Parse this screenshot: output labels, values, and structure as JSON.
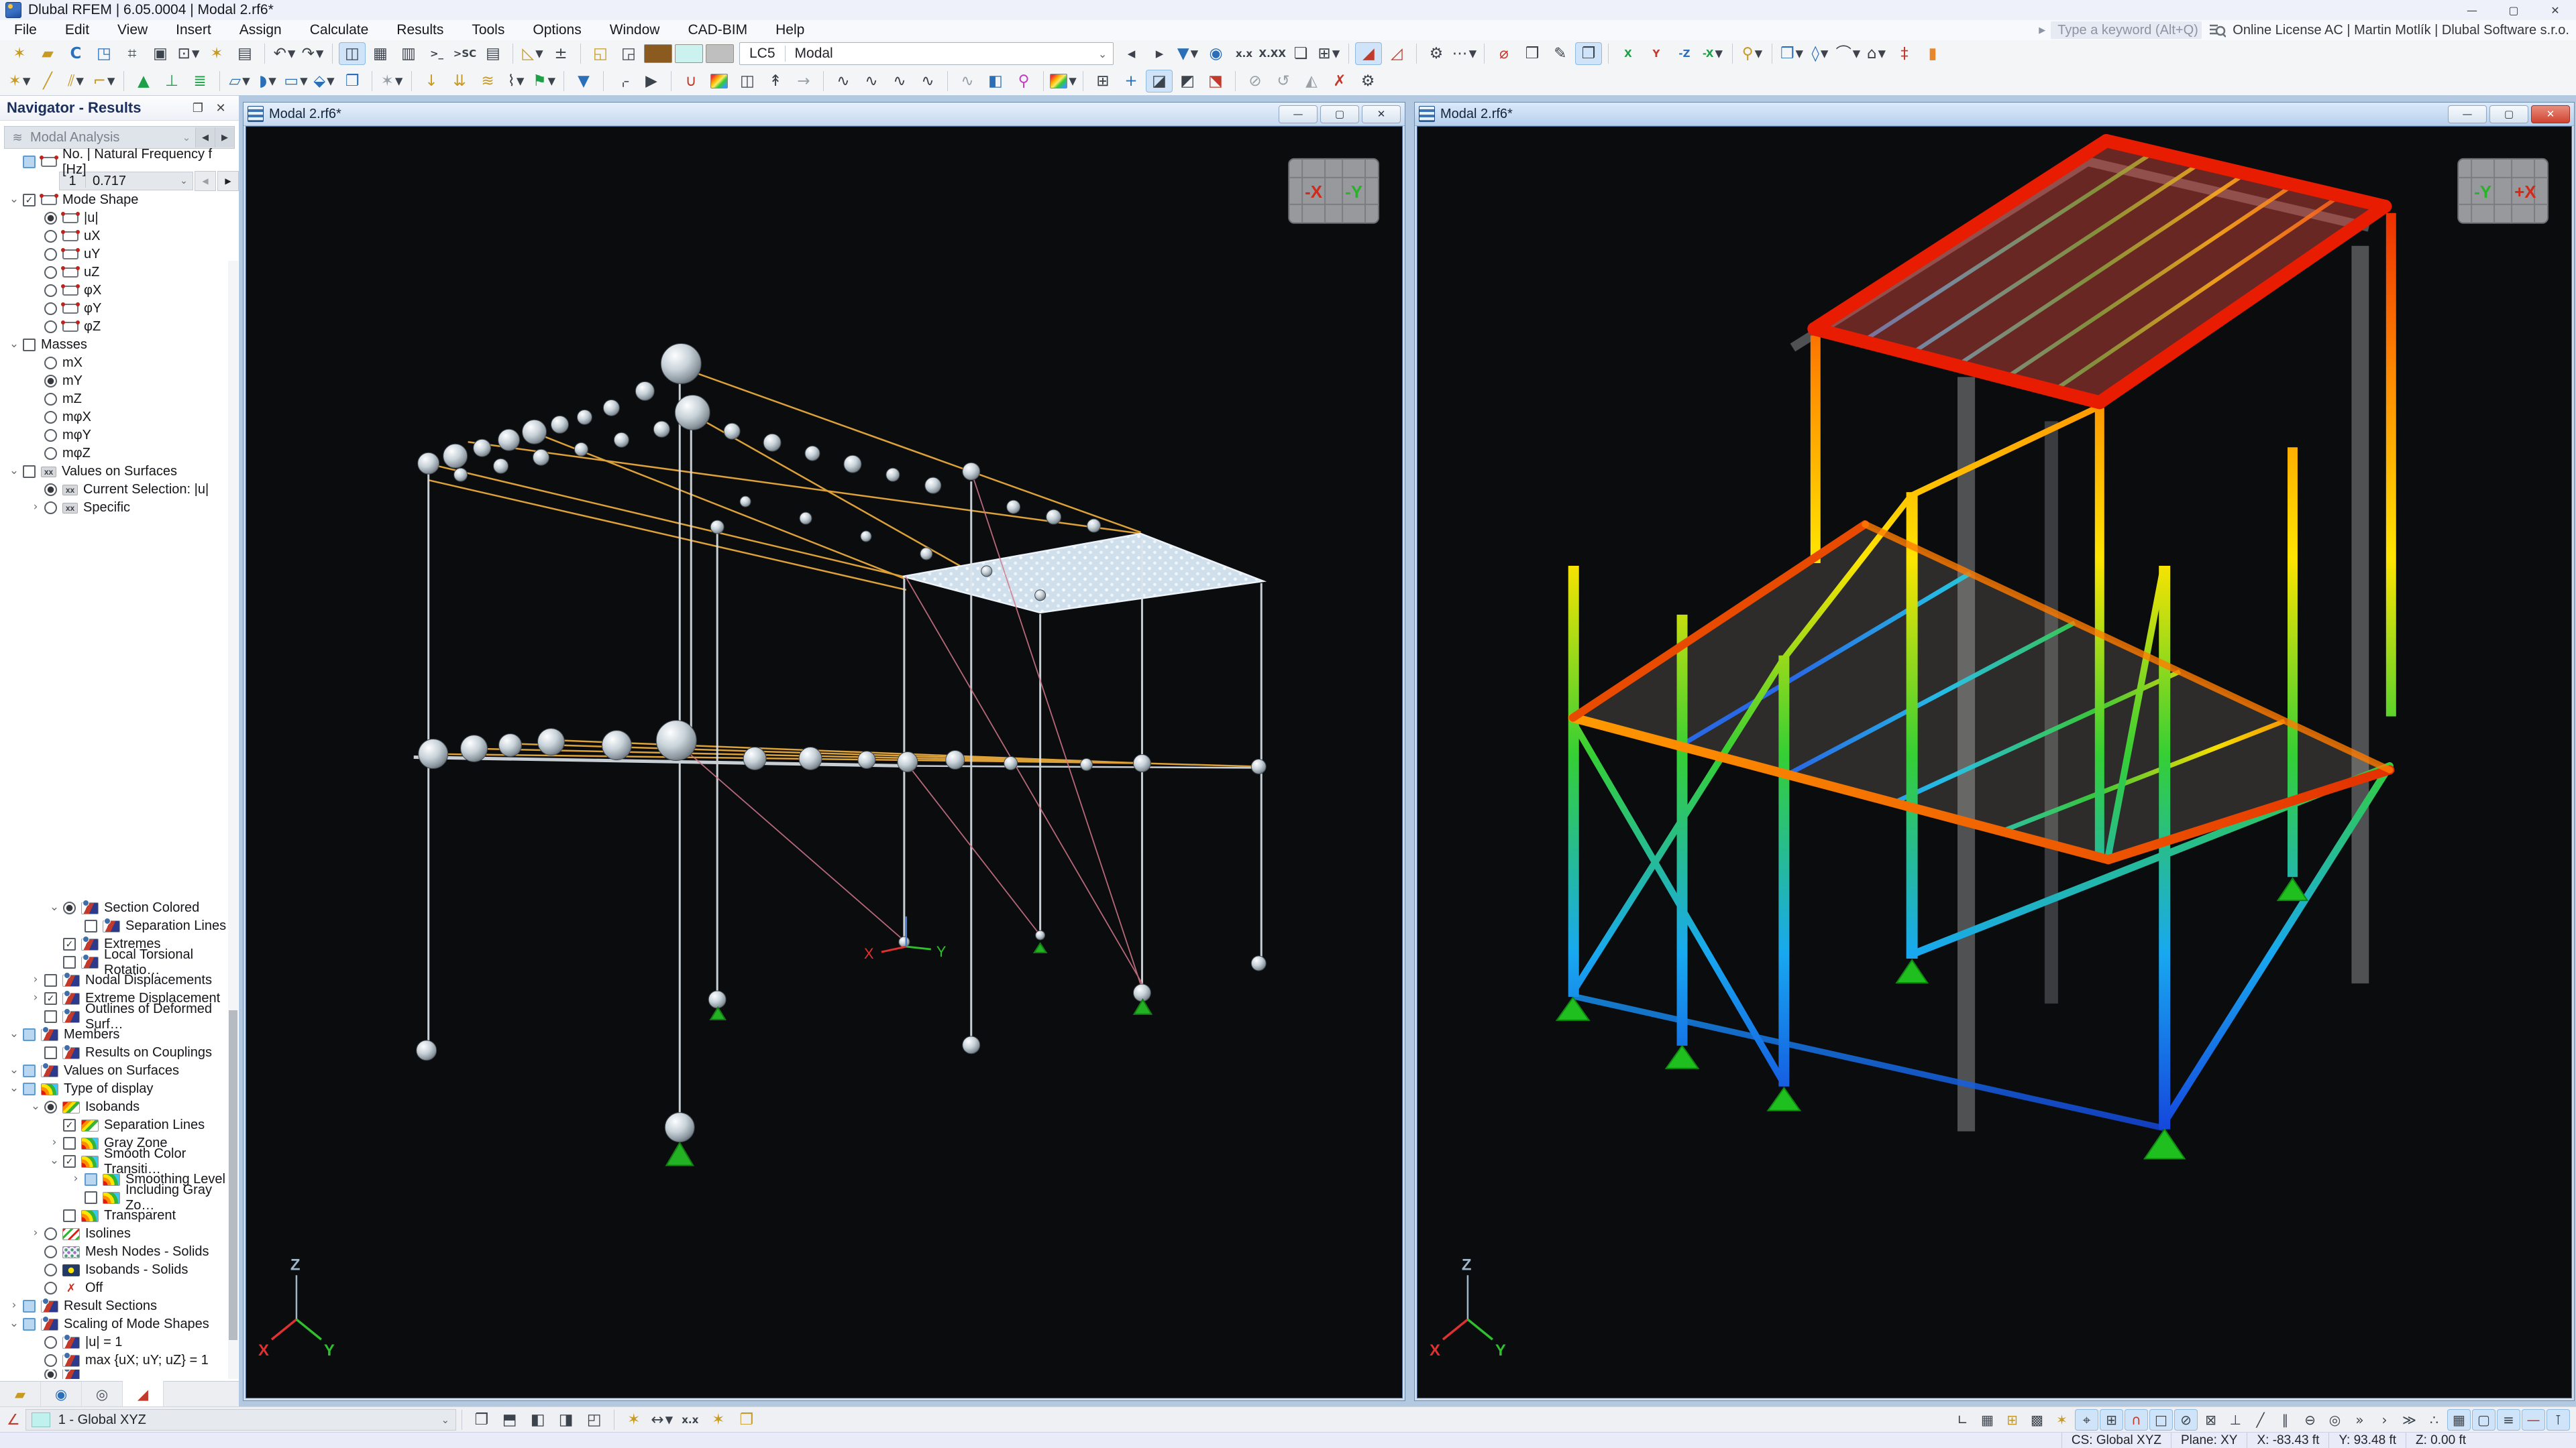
{
  "titlebar": {
    "title": "Dlubal RFEM | 6.05.0004 | Modal 2.rf6*",
    "minimize": "—",
    "maximize": "▢",
    "close": "✕"
  },
  "menubar": {
    "items": [
      "File",
      "Edit",
      "View",
      "Insert",
      "Assign",
      "Calculate",
      "Results",
      "Tools",
      "Options",
      "Window",
      "CAD-BIM",
      "Help"
    ]
  },
  "search": {
    "arrow": "▶",
    "placeholder": "Type a keyword (Alt+Q)",
    "license": "Online License AC | Martin Motlík | Dlubal Software s.r.o."
  },
  "toolbar_combo": {
    "case": "LC5",
    "value": "Modal",
    "chevron": "⌄"
  },
  "toolbar_main_a": {
    "items": [
      {
        "n": "new-model",
        "g": "✶",
        "cl": "c-gold"
      },
      {
        "n": "open-file",
        "g": "▰",
        "cl": "c-gold"
      },
      {
        "n": "block-manager",
        "g": "C",
        "cl": "c-blue b"
      },
      {
        "n": "model-3d-import",
        "g": "◳",
        "cl": "c-blue"
      },
      {
        "n": "edit-tables",
        "g": "⌗"
      },
      {
        "n": "save",
        "g": "▣"
      },
      {
        "n": "print",
        "g": "⊡",
        "dd": 1
      },
      {
        "n": "new-printout-report",
        "g": "✶",
        "cl": "c-gold"
      },
      {
        "n": "printout-report",
        "g": "▤"
      },
      {
        "sep": 1
      },
      {
        "n": "undo",
        "g": "↶",
        "dd": 1
      },
      {
        "n": "redo",
        "g": "↷",
        "dd": 1
      },
      {
        "sep": 1
      },
      {
        "n": "table-panel",
        "g": "◫",
        "hl": 1
      },
      {
        "n": "spreadsheet",
        "g": "▦"
      },
      {
        "n": "result-tables",
        "g": "▥"
      },
      {
        "n": "console",
        "g": ">_",
        "sm": 1
      },
      {
        "n": "script-console",
        "g": ">SC",
        "sm": 1
      },
      {
        "n": "table-view",
        "g": "▤"
      },
      {
        "sep": 1
      },
      {
        "n": "select-surface",
        "g": "◺",
        "cl": "c-gold",
        "dd": 1
      },
      {
        "n": "select-annotation",
        "g": "±"
      },
      {
        "sep": 1
      },
      {
        "n": "new-window",
        "g": "◱",
        "cl": "c-gold"
      },
      {
        "n": "window-import",
        "g": "◲"
      },
      {
        "sw": "#8a5a1f",
        "n": "swatch-brown"
      },
      {
        "sw": "#ccf2ef",
        "n": "swatch-cyan"
      },
      {
        "sw": "#bfbfbf",
        "n": "swatch-gray"
      }
    ]
  },
  "toolbar_main_b": {
    "items": [
      {
        "n": "prev-load-case",
        "g": "◀",
        "sm": 1
      },
      {
        "n": "next-load-case",
        "g": "▶",
        "sm": 1
      },
      {
        "n": "filter-results",
        "g": "▼",
        "cl": "c-blue",
        "dd": 1
      },
      {
        "n": "show-results",
        "g": "◉",
        "cl": "c-blue"
      },
      {
        "n": "show-result-values",
        "g": "x.x",
        "sm": 1
      },
      {
        "n": "show-all-values",
        "g": "X.XX",
        "sm": 1
      },
      {
        "n": "result-layers",
        "g": "❏"
      },
      {
        "n": "result-grid-values",
        "g": "⊞",
        "dd": 1
      },
      {
        "sep": 1
      },
      {
        "n": "result-diagram",
        "g": "◢",
        "cl": "c-red",
        "hl": 1
      },
      {
        "n": "result-diagram-values",
        "g": "◿",
        "cl": "c-red"
      },
      {
        "sep": 1
      },
      {
        "n": "save-result-settings",
        "g": "⚙"
      },
      {
        "n": "result-panel",
        "g": "⋯",
        "dd": 1
      },
      {
        "sep": 1
      },
      {
        "n": "zoom-clear",
        "g": "⌀",
        "cl": "c-red"
      },
      {
        "n": "view-solid-model",
        "g": "❒"
      },
      {
        "n": "edit-view",
        "g": "✎"
      },
      {
        "n": "duplicate-view",
        "g": "❐",
        "hl": 1
      },
      {
        "sep": 1
      },
      {
        "n": "view-x",
        "g": "X",
        "cl": "c-green",
        "sm": 1
      },
      {
        "n": "view-y",
        "g": "Y",
        "cl": "c-red",
        "sm": 1
      },
      {
        "n": "view-minus-z",
        "g": "-Z",
        "cl": "c-blue",
        "sm": 1
      },
      {
        "n": "view-minus-x",
        "g": "-X",
        "cl": "c-green",
        "sm": 1,
        "dd": 1
      },
      {
        "sep": 1
      },
      {
        "n": "light-settings",
        "g": "⚲",
        "cl": "c-gold",
        "dd": 1
      },
      {
        "sep": 1
      },
      {
        "n": "new-solid",
        "g": "❒",
        "cl": "c-blue",
        "dd": 1
      },
      {
        "n": "new-plane",
        "g": "◊",
        "cl": "c-blue",
        "dd": 1
      },
      {
        "n": "new-cable",
        "g": "⌒",
        "dd": 1
      },
      {
        "n": "new-column",
        "g": "⌂",
        "dd": 1
      },
      {
        "n": "member-with-nodes",
        "g": "‡",
        "cl": "c-red"
      },
      {
        "n": "orange-wall-panel",
        "g": "▮",
        "cl": "c-orange"
      }
    ]
  },
  "toolbar_insert": {
    "items": [
      {
        "n": "new-node",
        "g": "✶",
        "cl": "c-gold",
        "dd": 1
      },
      {
        "n": "new-line",
        "g": "╱",
        "cl": "c-gold"
      },
      {
        "n": "new-member",
        "g": "⫽",
        "cl": "c-gold",
        "dd": 1
      },
      {
        "n": "new-polyline",
        "g": "⌐",
        "cl": "c-gold",
        "dd": 1
      },
      {
        "sep": 1
      },
      {
        "n": "new-nodal-support",
        "g": "▲",
        "cl": "c-green"
      },
      {
        "n": "new-line-support",
        "g": "⊥",
        "cl": "c-green"
      },
      {
        "n": "new-surface-support",
        "g": "≣",
        "cl": "c-green"
      },
      {
        "sep": 1
      },
      {
        "n": "new-surface",
        "g": "▱",
        "cl": "c-blue",
        "dd": 1
      },
      {
        "n": "new-opening",
        "g": "◗",
        "cl": "c-blue",
        "dd": 1
      },
      {
        "n": "new-rect-opening",
        "g": "▭",
        "cl": "c-blue",
        "dd": 1
      },
      {
        "n": "new-solid-object",
        "g": "⬙",
        "cl": "c-blue",
        "dd": 1
      },
      {
        "n": "new-block",
        "g": "❐",
        "cl": "c-blue"
      },
      {
        "sep": 1
      },
      {
        "n": "new-gray-object",
        "g": "✶",
        "cl": "c-gray",
        "dd": 1
      },
      {
        "sep": 1
      },
      {
        "n": "new-nodal-load",
        "g": "↓",
        "cl": "c-gold"
      },
      {
        "n": "new-member-load",
        "g": "⇊",
        "cl": "c-gold"
      },
      {
        "n": "new-surface-load",
        "g": "≋",
        "cl": "c-gold"
      },
      {
        "n": "new-imperfection",
        "g": "⌇",
        "dd": 1
      },
      {
        "n": "load-wizard",
        "g": "⚑",
        "cl": "c-green",
        "dd": 1
      },
      {
        "sep": 1
      },
      {
        "n": "visibility-filter",
        "g": "▼",
        "cl": "c-blue"
      },
      {
        "sep": 1
      },
      {
        "n": "select-window",
        "g": "⌌"
      },
      {
        "n": "animation",
        "g": "▶"
      },
      {
        "sep": 1
      },
      {
        "n": "catenary-shape",
        "g": "∪",
        "cl": "c-red"
      },
      {
        "n": "rainbow-surface-results",
        "g": "",
        "cl": "rbic"
      },
      {
        "n": "sound-analysis",
        "g": "◫"
      },
      {
        "n": "walk-through-mode",
        "g": "↟"
      },
      {
        "n": "fly-mode",
        "g": "→",
        "cl": "c-gray"
      },
      {
        "sep": 1
      },
      {
        "n": "result-beam-min",
        "g": "∿"
      },
      {
        "n": "result-beam-avg",
        "g": "∿"
      },
      {
        "n": "result-beam-max",
        "g": "∿"
      },
      {
        "n": "result-beam-all",
        "g": "∿"
      },
      {
        "sep": 1
      },
      {
        "n": "section-result",
        "g": "∿",
        "cl": "c-gray"
      },
      {
        "n": "new-visual-object",
        "g": "◧",
        "cl": "c-blue"
      },
      {
        "n": "pin-object",
        "g": "⚲",
        "cl": "c-magenta"
      },
      {
        "sep": 1
      },
      {
        "n": "color-scale-edit",
        "g": "",
        "cl": "rbic",
        "dd": 1
      },
      {
        "sep": 1
      },
      {
        "n": "mesh-settings",
        "g": "⊞"
      },
      {
        "n": "mesh-refinement",
        "g": "+",
        "cl": "c-blue"
      },
      {
        "n": "section-plane-xy",
        "g": "◪",
        "hl": 1
      },
      {
        "n": "section-plane-yz",
        "g": "◩"
      },
      {
        "n": "section-plane-xz",
        "g": "⬔",
        "cl": "c-red"
      },
      {
        "sep": 1
      },
      {
        "n": "detach-objects",
        "g": "⊘",
        "cl": "c-gray"
      },
      {
        "n": "rotate-copy",
        "g": "↺",
        "cl": "c-gray"
      },
      {
        "n": "mirror-copy",
        "g": "◭",
        "cl": "c-gray"
      },
      {
        "n": "intersection",
        "g": "✗",
        "cl": "c-red"
      },
      {
        "n": "calculation-parameters",
        "g": "⚙"
      }
    ]
  },
  "navigator": {
    "title": "Navigator - Results",
    "float_btn": "❐",
    "close_btn": "✕",
    "analysis": {
      "icon_glyph": "≋",
      "value": "Modal Analysis",
      "chevron": "⌄",
      "prev": "◀",
      "next": "▶"
    },
    "frequency": {
      "number": "1",
      "value": "0.717",
      "chevron": "⌄",
      "prev": "◀",
      "next": "▶"
    },
    "tree_top_a": [
      {
        "t": "No. | Natural Frequency f [Hz]",
        "l": 1,
        "e": "",
        "c": "cbf",
        "i": "frame"
      }
    ],
    "tree_top_b": [
      {
        "t": "Mode Shape",
        "l": 1,
        "e": "v",
        "c": "cbc",
        "i": "frame"
      },
      {
        "t": "|u|",
        "l": 2,
        "e": "",
        "c": "rbs",
        "i": "frame"
      },
      {
        "t": "uX",
        "l": 2,
        "e": "",
        "c": "rb",
        "i": "frame"
      },
      {
        "t": "uY",
        "l": 2,
        "e": "",
        "c": "rb",
        "i": "frame"
      },
      {
        "t": "uZ",
        "l": 2,
        "e": "",
        "c": "rb",
        "i": "frame"
      },
      {
        "t": "φX",
        "l": 2,
        "e": "",
        "c": "rb",
        "i": "frame"
      },
      {
        "t": "φY",
        "l": 2,
        "e": "",
        "c": "rb",
        "i": "frame"
      },
      {
        "t": "φZ",
        "l": 2,
        "e": "",
        "c": "rb",
        "i": "frame"
      },
      {
        "t": "Masses",
        "l": 1,
        "e": "v",
        "c": "cb",
        "i": ""
      },
      {
        "t": "mX",
        "l": 2,
        "e": "",
        "c": "rb",
        "i": ""
      },
      {
        "t": "mY",
        "l": 2,
        "e": "",
        "c": "rbs",
        "i": ""
      },
      {
        "t": "mZ",
        "l": 2,
        "e": "",
        "c": "rb",
        "i": ""
      },
      {
        "t": "mφX",
        "l": 2,
        "e": "",
        "c": "rb",
        "i": ""
      },
      {
        "t": "mφY",
        "l": 2,
        "e": "",
        "c": "rb",
        "i": ""
      },
      {
        "t": "mφZ",
        "l": 2,
        "e": "",
        "c": "rb",
        "i": ""
      },
      {
        "t": "Values on Surfaces",
        "l": 1,
        "e": "v",
        "c": "cb",
        "i": "xx"
      },
      {
        "t": "Current Selection: |u|",
        "l": 2,
        "e": "",
        "c": "rbs",
        "i": "xx"
      },
      {
        "t": "Specific",
        "l": 2,
        "e": ">",
        "c": "rb",
        "i": "xx"
      }
    ],
    "tree_bottom": [
      {
        "t": "Section Colored",
        "l": 3,
        "e": "v",
        "c": "rbs",
        "i": "wedge"
      },
      {
        "t": "Separation Lines",
        "l": 4,
        "e": "",
        "c": "cb",
        "i": "wedge"
      },
      {
        "t": "Extremes",
        "l": 3,
        "e": "",
        "c": "cbc",
        "i": "wedge"
      },
      {
        "t": "Local Torsional Rotatio…",
        "l": 3,
        "e": "",
        "c": "cb",
        "i": "wedge"
      },
      {
        "t": "Nodal Displacements",
        "l": 2,
        "e": ">",
        "c": "cb",
        "i": "wedge"
      },
      {
        "t": "Extreme Displacement",
        "l": 2,
        "e": ">",
        "c": "cbc",
        "i": "wedge"
      },
      {
        "t": "Outlines of Deformed Surf…",
        "l": 2,
        "e": "",
        "c": "cb",
        "i": "wedge"
      },
      {
        "t": "Members",
        "l": 1,
        "e": "v",
        "c": "cbf",
        "i": "wedge"
      },
      {
        "t": "Results on Couplings",
        "l": 2,
        "e": "",
        "c": "cb",
        "i": "wedge"
      },
      {
        "t": "Values on Surfaces",
        "l": 1,
        "e": "v",
        "c": "cbf",
        "i": "wedge"
      },
      {
        "t": "Type of display",
        "l": 1,
        "e": "v",
        "c": "cbf",
        "i": "rainbow"
      },
      {
        "t": "Isobands",
        "l": 2,
        "e": "v",
        "c": "rbs",
        "i": "isoband"
      },
      {
        "t": "Separation Lines",
        "l": 3,
        "e": "",
        "c": "cbc",
        "i": "isoband"
      },
      {
        "t": "Gray Zone",
        "l": 3,
        "e": ">",
        "c": "cb",
        "i": "rainbow"
      },
      {
        "t": "Smooth Color Transiti…",
        "l": 3,
        "e": "v",
        "c": "cbc",
        "i": "rainbow"
      },
      {
        "t": "Smoothing Level",
        "l": 4,
        "e": ">",
        "c": "cbf",
        "i": "rainbow"
      },
      {
        "t": "Including Gray Zo…",
        "l": 4,
        "e": "",
        "c": "cb",
        "i": "rainbow"
      },
      {
        "t": "Transparent",
        "l": 3,
        "e": "",
        "c": "cb",
        "i": "rainbow"
      },
      {
        "t": "Isolines",
        "l": 2,
        "e": ">",
        "c": "rb",
        "i": "isoline"
      },
      {
        "t": "Mesh Nodes - Solids",
        "l": 2,
        "e": "",
        "c": "rb",
        "i": "mesh"
      },
      {
        "t": "Isobands - Solids",
        "l": 2,
        "e": "",
        "c": "rb",
        "i": "solid"
      },
      {
        "t": "Off",
        "l": 2,
        "e": "",
        "c": "rb",
        "i": "off"
      },
      {
        "t": "Result Sections",
        "l": 1,
        "e": ">",
        "c": "cbf",
        "i": "wedge"
      },
      {
        "t": "Scaling of Mode Shapes",
        "l": 1,
        "e": "v",
        "c": "cbf",
        "i": "wedge"
      },
      {
        "t": "|u| = 1",
        "l": 2,
        "e": "",
        "c": "rb",
        "i": "wedge"
      },
      {
        "t": "max {uX; uY; uZ} = 1",
        "l": 2,
        "e": "",
        "c": "rb",
        "i": "wedge"
      },
      {
        "t": "",
        "l": 2,
        "e": "",
        "c": "rbs",
        "i": "wedge"
      }
    ],
    "tabs": [
      {
        "n": "tab-data",
        "g": "▰",
        "cl": "c-gold"
      },
      {
        "n": "tab-display",
        "g": "◉",
        "cl": "c-blue"
      },
      {
        "n": "tab-views",
        "g": "◎"
      },
      {
        "n": "tab-results",
        "g": "◢",
        "cl": "c-red",
        "act": 1
      }
    ]
  },
  "viewport_left": {
    "title": "Modal 2.rf6*",
    "minimize": "—",
    "maximize": "▢",
    "close": "✕",
    "cube": {
      "a": "-X",
      "b": "-Y"
    },
    "triad": {
      "x": "X",
      "y": "Y",
      "z": "Z"
    },
    "marker": {
      "x": "X",
      "y": "Y"
    }
  },
  "viewport_right": {
    "title": "Modal 2.rf6*",
    "minimize": "—",
    "maximize": "▢",
    "close": "✕",
    "cube": {
      "a": "-Y",
      "b": "+X"
    },
    "triad": {
      "x": "X",
      "y": "Y",
      "z": "Z"
    }
  },
  "bottombar": {
    "cs_value": "1 - Global XYZ",
    "chevron": "⌄",
    "view_items": [
      {
        "n": "view-isometric",
        "g": "❐"
      },
      {
        "n": "view-top",
        "g": "⬒"
      },
      {
        "n": "view-front",
        "g": "◧"
      },
      {
        "n": "view-side",
        "g": "◨"
      },
      {
        "n": "view-rotate",
        "g": "◰"
      },
      {
        "sep": 1
      },
      {
        "n": "new-guide-object",
        "g": "✶",
        "cl": "c-gold"
      },
      {
        "n": "measure",
        "g": "↔",
        "dd": 1
      },
      {
        "n": "dimensions",
        "g": "x.x",
        "sm": 1
      },
      {
        "n": "comment-pointer",
        "g": "✶",
        "cl": "c-gold"
      },
      {
        "n": "visibility-box",
        "g": "❐",
        "cl": "c-gold"
      }
    ],
    "snap_items": [
      {
        "n": "origin-corner",
        "g": "∟"
      },
      {
        "n": "grid-points-visibility",
        "g": "▦"
      },
      {
        "n": "grid-new",
        "g": "⊞",
        "cl": "c-gold"
      },
      {
        "n": "grid-numbering",
        "g": "▩"
      },
      {
        "n": "object-snap-new",
        "g": "✶",
        "cl": "c-gold"
      },
      {
        "n": "snap-cursor",
        "g": "⌖",
        "hl": 1
      },
      {
        "n": "grid-snap",
        "g": "⊞",
        "hl": 1
      },
      {
        "n": "magnet-snap",
        "g": "∩",
        "cl": "c-red",
        "hl": 1
      },
      {
        "n": "snap-endpoint",
        "g": "□",
        "hl": 1
      },
      {
        "n": "snap-center",
        "g": "⊘",
        "hl": 1
      },
      {
        "n": "snap-intersection",
        "g": "⊠"
      },
      {
        "n": "snap-perpendicular",
        "g": "⊥"
      },
      {
        "n": "snap-nearest",
        "g": "╱"
      },
      {
        "n": "snap-parallel",
        "g": "∥"
      },
      {
        "n": "snap-tangent",
        "g": "⊖"
      },
      {
        "n": "snap-quadrant",
        "g": "◎"
      },
      {
        "n": "snap-extension",
        "g": "»"
      },
      {
        "n": "snap-from",
        "g": "›"
      },
      {
        "n": "snap-offset",
        "g": "≫"
      },
      {
        "n": "snap-divisions",
        "g": "∴"
      },
      {
        "n": "show-grid",
        "g": "▦",
        "hl": 1
      },
      {
        "n": "work-plane",
        "g": "▢",
        "hl": 1
      },
      {
        "n": "layers",
        "g": "≡",
        "hl": 1
      },
      {
        "n": "guideline",
        "g": "—",
        "cl": "c-red",
        "hl": 1
      },
      {
        "n": "plumb-line",
        "g": "⊺",
        "hl": 1
      }
    ]
  },
  "statusbar": {
    "fields": [
      "CS: Global XYZ",
      "Plane: XY",
      "X: -83.43 ft",
      "Y: 93.48 ft",
      "Z: 0.00 ft"
    ]
  }
}
